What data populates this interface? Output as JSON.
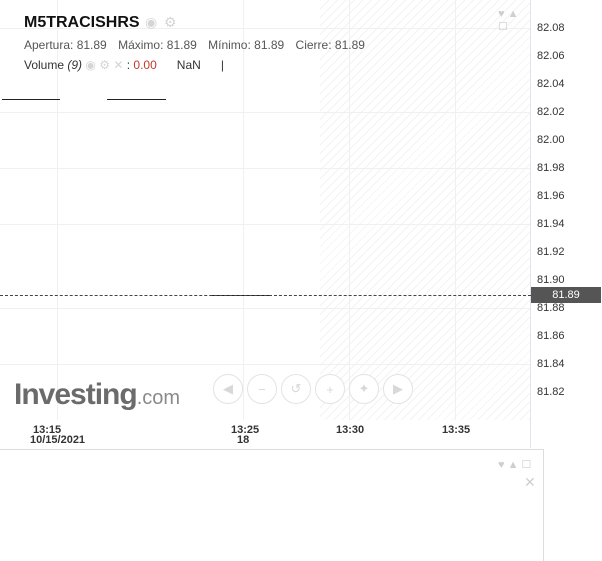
{
  "symbol": "M5TRACISHRS",
  "ohlc": {
    "open_label": "Apertura:",
    "open": "81.89",
    "high_label": "Máximo:",
    "high": "81.89",
    "low_label": "Mínimo:",
    "low": "81.89",
    "close_label": "Cierre:",
    "close": "81.89"
  },
  "volume": {
    "label": "Volume",
    "param": "(9)",
    "value": "0.00",
    "nan": "NaN",
    "sep": "|"
  },
  "y_ticks": [
    "82.08",
    "82.06",
    "82.04",
    "82.02",
    "82.00",
    "81.98",
    "81.96",
    "81.94",
    "81.92",
    "81.90",
    "81.88",
    "81.86",
    "81.84",
    "81.82"
  ],
  "current_price": "81.89",
  "x_ticks": [
    {
      "label": "13:15",
      "sub": "10/15/2021"
    },
    {
      "label": "13:25",
      "sub": "18"
    },
    {
      "label": "13:30",
      "sub": ""
    },
    {
      "label": "13:35",
      "sub": ""
    }
  ],
  "logo": {
    "main": "Investing",
    "suffix": ".com"
  },
  "icons": {
    "visibility": "eye-icon",
    "settings": "gear-icon",
    "close": "close-icon",
    "scroll_left": "arrow-left-icon",
    "zoom_out": "zoom-out-icon",
    "reset": "reset-icon",
    "zoom_in": "zoom-in-icon",
    "fit": "fit-icon",
    "scroll_right": "arrow-right-icon"
  }
}
